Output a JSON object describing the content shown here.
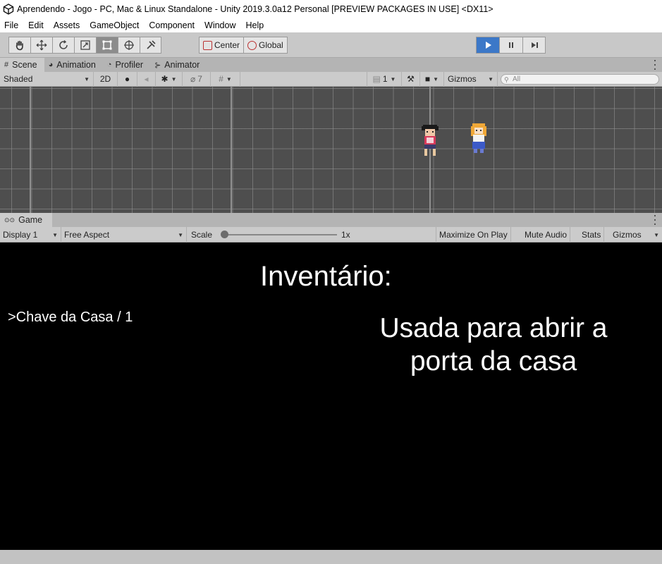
{
  "window": {
    "title": "Aprendendo - Jogo - PC, Mac & Linux Standalone - Unity 2019.3.0a12 Personal [PREVIEW PACKAGES IN USE] <DX11>"
  },
  "menu": [
    "File",
    "Edit",
    "Assets",
    "GameObject",
    "Component",
    "Window",
    "Help"
  ],
  "toolbar": {
    "tools": [
      "hand-tool-icon",
      "move-tool-icon",
      "rotate-tool-icon",
      "scale-tool-icon",
      "rect-tool-icon",
      "transform-tool-icon",
      "custom-tool-icon"
    ],
    "active_tool": "rect-tool-icon",
    "pivot_mode": "Center",
    "pivot_rotation": "Global",
    "play_controls": [
      "play-icon",
      "pause-icon",
      "step-icon"
    ],
    "play_color": "#3c78c8"
  },
  "scene_tabs": [
    {
      "label": "Scene",
      "icon": "#"
    },
    {
      "label": "Animation",
      "icon": "◕"
    },
    {
      "label": "Profiler",
      "icon": "◔"
    },
    {
      "label": "Animator",
      "icon": "⊱"
    }
  ],
  "scene_bar": {
    "draw_mode": "Shaded",
    "mode_2d": "2D",
    "hidden_count": "7",
    "layers": "1",
    "gizmos": "Gizmos",
    "search_placeholder": "All"
  },
  "game_tab": {
    "label": "Game",
    "icon": "⊙⊙"
  },
  "game_bar": {
    "display": "Display 1",
    "aspect": "Free Aspect",
    "scale_label": "Scale",
    "scale_value": "1x",
    "maximize": "Maximize On Play",
    "mute": "Mute Audio",
    "stats": "Stats",
    "gizmos": "Gizmos"
  },
  "game_view": {
    "inventory_title": "Inventário:",
    "item": ">Chave da Casa / 1",
    "description": "Usada para abrir a porta da casa"
  }
}
